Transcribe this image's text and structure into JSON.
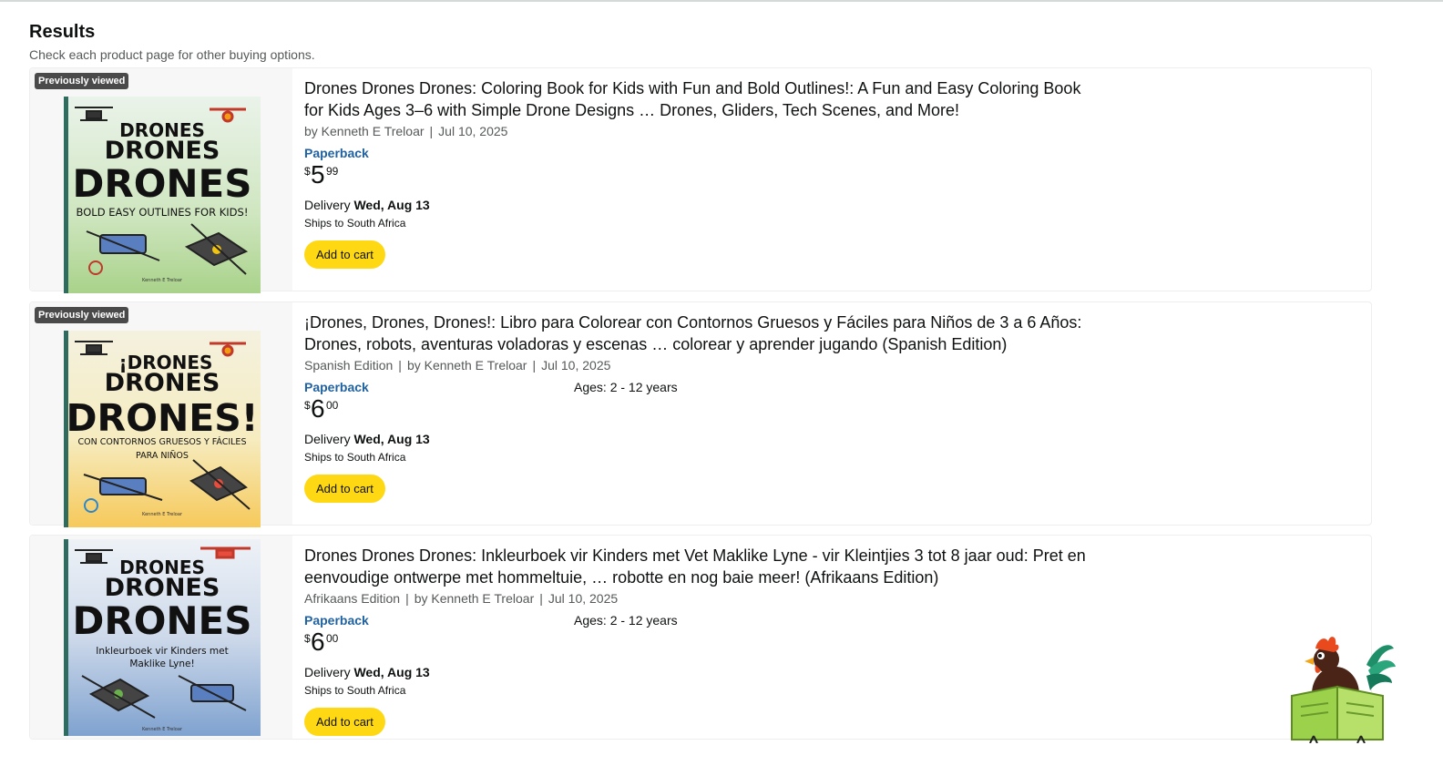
{
  "header": {
    "title": "Results",
    "subtitle": "Check each product page for other buying options."
  },
  "products": [
    {
      "badge": "Previously viewed",
      "title_line1": "Drones Drones Drones: Coloring Book for Kids with Fun and Bold Outlines!: A Fun and Easy Coloring Book",
      "title_line2": "for Kids Ages 3–6 with Simple Drone Designs … Drones, Gliders, Tech Scenes, and More!",
      "edition": "",
      "author": "by Kenneth E Treloar",
      "date": "Jul 10, 2025",
      "format": "Paperback",
      "ages": "",
      "price_symbol": "$",
      "price_whole": "5",
      "price_fraction": "99",
      "delivery_label": "Delivery",
      "delivery_date": "Wed, Aug 13",
      "ships": "Ships to South Africa",
      "button": "Add to cart",
      "cover": {
        "line1": "DRONES",
        "line2": "DRONES",
        "line3": "DRONES",
        "tagline": "BOLD EASY OUTLINES FOR KIDS!",
        "tagline2": "",
        "author_small": "Kenneth E Treloar",
        "bg_top": "#5f9fa6",
        "bg_bottom": "#a9d28a"
      }
    },
    {
      "badge": "Previously viewed",
      "title_line1": "¡Drones, Drones, Drones!: Libro para Colorear con Contornos Gruesos y Fáciles para Niños de 3 a 6 Años:",
      "title_line2": "Drones, robots, aventuras voladoras y escenas … colorear y aprender jugando (Spanish Edition)",
      "edition": "Spanish Edition",
      "author": "by Kenneth E Treloar",
      "date": "Jul 10, 2025",
      "format": "Paperback",
      "ages": "Ages: 2 - 12 years",
      "price_symbol": "$",
      "price_whole": "6",
      "price_fraction": "00",
      "delivery_label": "Delivery",
      "delivery_date": "Wed, Aug 13",
      "ships": "Ships to South Africa",
      "button": "Add to cart",
      "cover": {
        "line1": "¡DRONES",
        "line2": "DRONES",
        "line3": "DRONES!",
        "tagline": "CON CONTORNOS GRUESOS Y FÁCILES",
        "tagline2": "PARA NIÑOS",
        "author_small": "Kenneth E Treloar",
        "bg_top": "#9ac6c4",
        "bg_bottom": "#f6c95a"
      }
    },
    {
      "badge": "",
      "title_line1": "Drones Drones Drones: Inkleurboek vir Kinders met Vet Maklike Lyne - vir Kleintjies 3 tot 8 jaar oud: Pret en",
      "title_line2": "eenvoudige ontwerpe met hommeltuie, … robotte en nog baie meer! (Afrikaans Edition)",
      "edition": "Afrikaans Edition",
      "author": "by Kenneth E Treloar",
      "date": "Jul 10, 2025",
      "format": "Paperback",
      "ages": "Ages: 2 - 12 years",
      "price_symbol": "$",
      "price_whole": "6",
      "price_fraction": "00",
      "delivery_label": "Delivery",
      "delivery_date": "Wed, Aug 13",
      "ships": "Ships to South Africa",
      "button": "Add to cart",
      "cover": {
        "line1": "DRONES",
        "line2": "DRONES",
        "line3": "DRONES",
        "tagline": "Inkleurboek vir Kinders met",
        "tagline2": "Maklike Lyne!",
        "author_small": "Kenneth E Treloar",
        "bg_top": "#dfe7f2",
        "bg_bottom": "#7fa2cf"
      }
    }
  ],
  "colors": {
    "accent_link": "#2162a1",
    "button": "#ffd814",
    "badge": "#4a4a4a"
  },
  "icons": [
    "drone-icon",
    "rooster-reading-mascot-icon"
  ]
}
